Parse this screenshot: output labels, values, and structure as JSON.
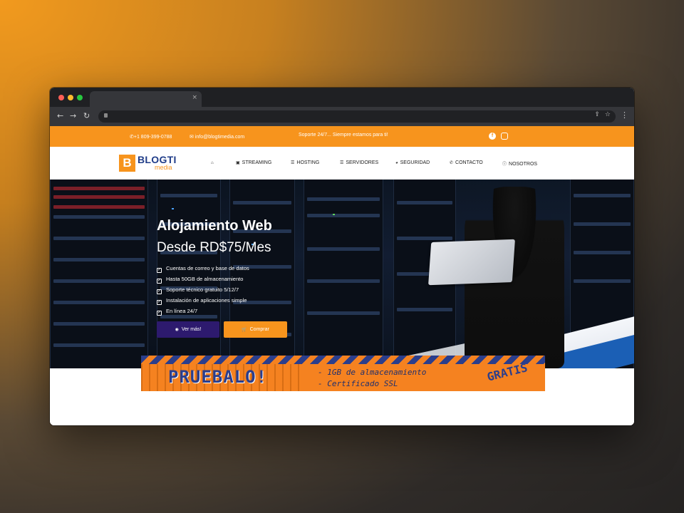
{
  "browser": {
    "tab_close": "×",
    "nav": {
      "back": "←",
      "forward": "→",
      "reload": "↻"
    },
    "omnibox": {
      "share": "⇪",
      "bookmark": "☆"
    },
    "menu": "⋮"
  },
  "topbar": {
    "phone": "+1 809-399-0788",
    "email": "info@blogtimedia.com",
    "support": "Soporte 24/7... Siempre estamos para ti!",
    "social": [
      "facebook-icon",
      "instagram-icon"
    ]
  },
  "logo": {
    "mark": "B",
    "name": "BLOGTI",
    "sub": "media"
  },
  "nav": [
    {
      "label": "",
      "icon": "⌂"
    },
    {
      "label": "STREAMING",
      "icon": "▣"
    },
    {
      "label": "HOSTING",
      "icon": "☰"
    },
    {
      "label": "SERVIDORES",
      "icon": "☰"
    },
    {
      "label": "SEGURIDAD",
      "icon": "◕"
    },
    {
      "label": "CONTACTO",
      "icon": "✆"
    },
    {
      "label": "NOSOTROS",
      "icon": "ⓘ"
    }
  ],
  "hero": {
    "title": "Alojamiento Web",
    "subtitle": "Desde RD$75/Mes",
    "features": [
      "Cuentas de correo y base de datos",
      "Hasta 50GB de almacenamiento",
      "Soporte técnico gratuito 5/12/7",
      "Instalación de aplicaciones simple",
      "En línea 24/7"
    ],
    "btn_more": "Ver más!",
    "btn_buy": "Comprar"
  },
  "promo": {
    "title": "PRUEBALO!",
    "line1": "- 1GB de almacenamiento",
    "line2": "- Certificado SSL",
    "tag": "GRATIS"
  },
  "colors": {
    "accent": "#f7941d",
    "primary": "#2d1a6e",
    "brand_blue": "#1f3c88"
  }
}
